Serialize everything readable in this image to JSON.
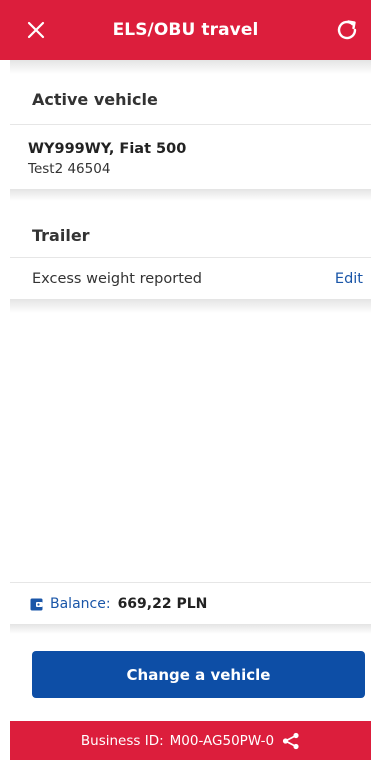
{
  "header": {
    "title": "ELS/OBU travel",
    "close_icon": "close-icon",
    "refresh_icon": "refresh-icon"
  },
  "active_vehicle": {
    "section_title": "Active vehicle",
    "name": "WY999WY, Fiat 500",
    "details": "Test2 46504"
  },
  "trailer": {
    "section_title": "Trailer",
    "status": "Excess weight reported",
    "edit_label": "Edit"
  },
  "balance": {
    "label": "Balance:",
    "value": "669,22 PLN",
    "icon": "wallet-icon"
  },
  "actions": {
    "change_vehicle_label": "Change a vehicle"
  },
  "footer": {
    "business_id_label": "Business ID:",
    "business_id_value": "M00-AG50PW-0",
    "share_icon": "share-icon"
  },
  "colors": {
    "brand_red": "#dc1e3c",
    "primary_blue": "#0d4ea6",
    "link_blue": "#1a56a8"
  }
}
